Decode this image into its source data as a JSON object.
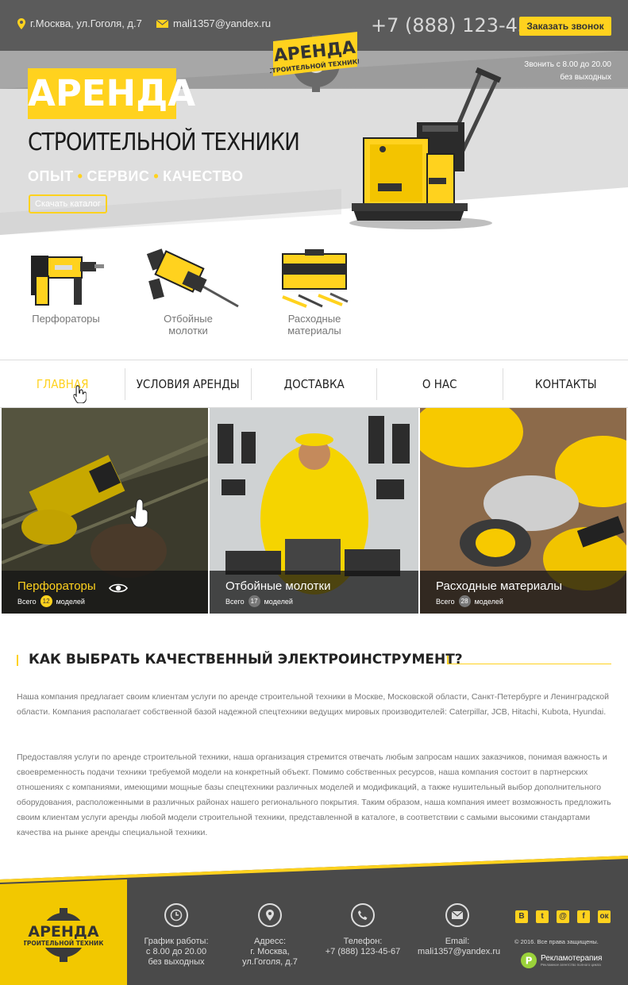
{
  "header": {
    "address": "г.Москва, ул.Гоголя, д.7",
    "email": "mali1357@yandex.ru",
    "phone": "+7 (888) 123-45-67",
    "callback_label": "Заказать звонок",
    "hours_line1": "Звонить с 8.00 до 20.00",
    "hours_line2": "без выходных"
  },
  "logo": {
    "title": "АРЕНДА",
    "subtitle": "СТРОИТЕЛЬНОЙ ТЕХНИКИ"
  },
  "hero": {
    "title": "АРЕНДА",
    "subtitle": "СТРОИТЕЛЬНОЙ ТЕХНИКИ",
    "tagline": [
      "ОПЫТ",
      "СЕРВИС",
      "КАЧЕСТВО"
    ],
    "catalog_label": "Скачать каталог"
  },
  "categories": [
    {
      "label": "Перфораторы",
      "icon": "rotary-hammer-icon"
    },
    {
      "label": "Отбойные молотки",
      "label_line1": "Отбойные",
      "label_line2": "молотки",
      "icon": "jackhammer-icon"
    },
    {
      "label": "Расходные материалы",
      "label_line1": "Расходные",
      "label_line2": "материалы",
      "icon": "toolbox-icon"
    }
  ],
  "menu": [
    {
      "label": "ГЛАВНАЯ",
      "active": true
    },
    {
      "label": "УСЛОВИЯ АРЕНДЫ"
    },
    {
      "label": "ДОСТАВКА"
    },
    {
      "label": "О НАС"
    },
    {
      "label": "КОНТАКТЫ"
    }
  ],
  "tiles": [
    {
      "title": "Перфораторы",
      "prefix": "Всего",
      "count": "12",
      "suffix": "моделей"
    },
    {
      "title": "Отбойные молотки",
      "prefix": "Всего",
      "count": "17",
      "suffix": "моделей"
    },
    {
      "title": "Расходные материалы",
      "prefix": "Всего",
      "count": "28",
      "suffix": "моделей"
    }
  ],
  "article": {
    "title": "КАК ВЫБРАТЬ КАЧЕСТВЕННЫЙ ЭЛЕКТРОИНСТРУМЕНТ?",
    "p1": "Наша компания предлагает своим клиентам услуги по аренде строительной техники в Москве, Московской области, Санкт-Петербурге и Ленинградской области. Компания располагает собственной базой надежной спецтехники ведущих мировых производителей: Caterpillar, JCB, Hitachi, Kubota, Hyundai.",
    "p2": "Предоставляя услуги по аренде строительной техники, наша организация стремится отвечать любым запросам наших заказчиков, понимая важность и своевременность подачи техники требуемой модели на конкретный объект. Помимо собственных ресурсов, наша компания состоит в партнерских отношениях с компаниями, имеющими мощные базы спецтехники различных моделей и модификаций, а также нушительный выбор дополнительного оборудования, расположенными в различных районах нашего регионального покрытия. Таким образом, наша компания имеет возможность предложить своим клиентам услуги аренды любой модели строительной техники, представленной в каталоге, в соответствии с самыми высокими стандартами качества на рынке аренды специальной техники."
  },
  "footer": {
    "schedule": {
      "line1": "График работы:",
      "line2": "с 8.00 до 20.00",
      "line3": "без выходных"
    },
    "address": {
      "line1": "Адресс:",
      "line2": "г. Москва,",
      "line3": "ул.Гоголя, д.7"
    },
    "phone": {
      "line1": "Телефон:",
      "line2": "+7 (888) 123-45-67"
    },
    "email": {
      "line1": "Email:",
      "line2": "mali1357@yandex.ru"
    },
    "social": [
      "В",
      "t",
      "@",
      "f",
      "ок"
    ],
    "copyright": "© 2016. Все права защищены.",
    "agency_name": "Рекламотерапия",
    "agency_sub": "Рекламное агентство полного цикла"
  },
  "colors": {
    "accent": "#ffd21e",
    "dark": "#4a4a4a"
  }
}
